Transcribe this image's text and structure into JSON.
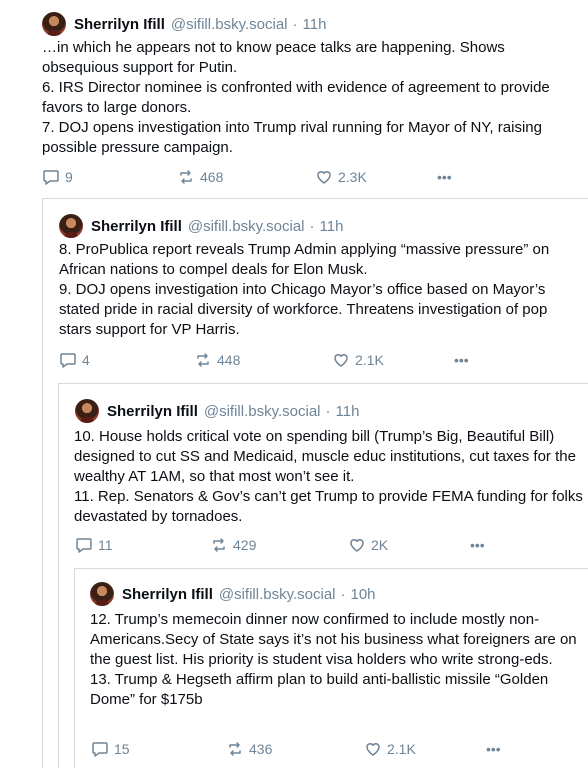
{
  "posts": [
    {
      "author": {
        "display_name": "Sherrilyn Ifill",
        "handle": "@sifill.bsky.social"
      },
      "separator": "·",
      "time": "11h",
      "lines": [
        "…in which he appears not to know peace talks are happening. Shows obsequious support for Putin.",
        "6. IRS Director nominee is confronted with evidence of agreement to provide favors to large donors.",
        "7. DOJ opens investigation into Trump rival running for Mayor of NY, raising possible pressure campaign."
      ],
      "replies": "9",
      "reposts": "468",
      "likes": "2.3K",
      "more": "•••"
    },
    {
      "author": {
        "display_name": "Sherrilyn Ifill",
        "handle": "@sifill.bsky.social"
      },
      "separator": "·",
      "time": "11h",
      "lines": [
        "8. ProPublica report reveals Trump Admin applying “massive pressure” on African nations to compel deals for Elon Musk.",
        "9. DOJ opens investigation into Chicago Mayor’s office based on Mayor’s stated pride in racial diversity of workforce.  Threatens investigation of pop stars support for VP Harris."
      ],
      "replies": "4",
      "reposts": "448",
      "likes": "2.1K",
      "more": "•••"
    },
    {
      "author": {
        "display_name": "Sherrilyn Ifill",
        "handle": "@sifill.bsky.social"
      },
      "separator": "·",
      "time": "11h",
      "lines": [
        "10. House holds critical vote on spending bill (Trump’s Big, Beautiful Bill) designed to cut SS and Medicaid, muscle educ institutions, cut taxes for the wealthy AT 1AM, so that most won’t see it.",
        "11. Rep. Senators & Gov’s can’t get Trump to provide FEMA funding for folks devastated by tornadoes."
      ],
      "replies": "11",
      "reposts": "429",
      "likes": "2K",
      "more": "•••"
    },
    {
      "author": {
        "display_name": "Sherrilyn Ifill",
        "handle": "@sifill.bsky.social"
      },
      "separator": "·",
      "time": "10h",
      "lines": [
        "12. Trump’s memecoin dinner now confirmed to include mostly non-Americans.Secy of State says it’s not his business what foreigners are on the guest list. His priority is student visa holders who write strong-eds.",
        "13. Trump & Hegseth affirm plan to build anti-ballistic missile “Golden Dome” for $175b"
      ],
      "replies": "15",
      "reposts": "436",
      "likes": "2.1K",
      "more": "•••"
    }
  ],
  "icons": {
    "reply": "reply-bubble-icon",
    "repost": "repost-arrows-icon",
    "like": "heart-icon",
    "more": "more-dots-icon"
  },
  "colors": {
    "text": "#0b0f14",
    "muted": "#6f8597",
    "border": "#d4dbe2"
  }
}
